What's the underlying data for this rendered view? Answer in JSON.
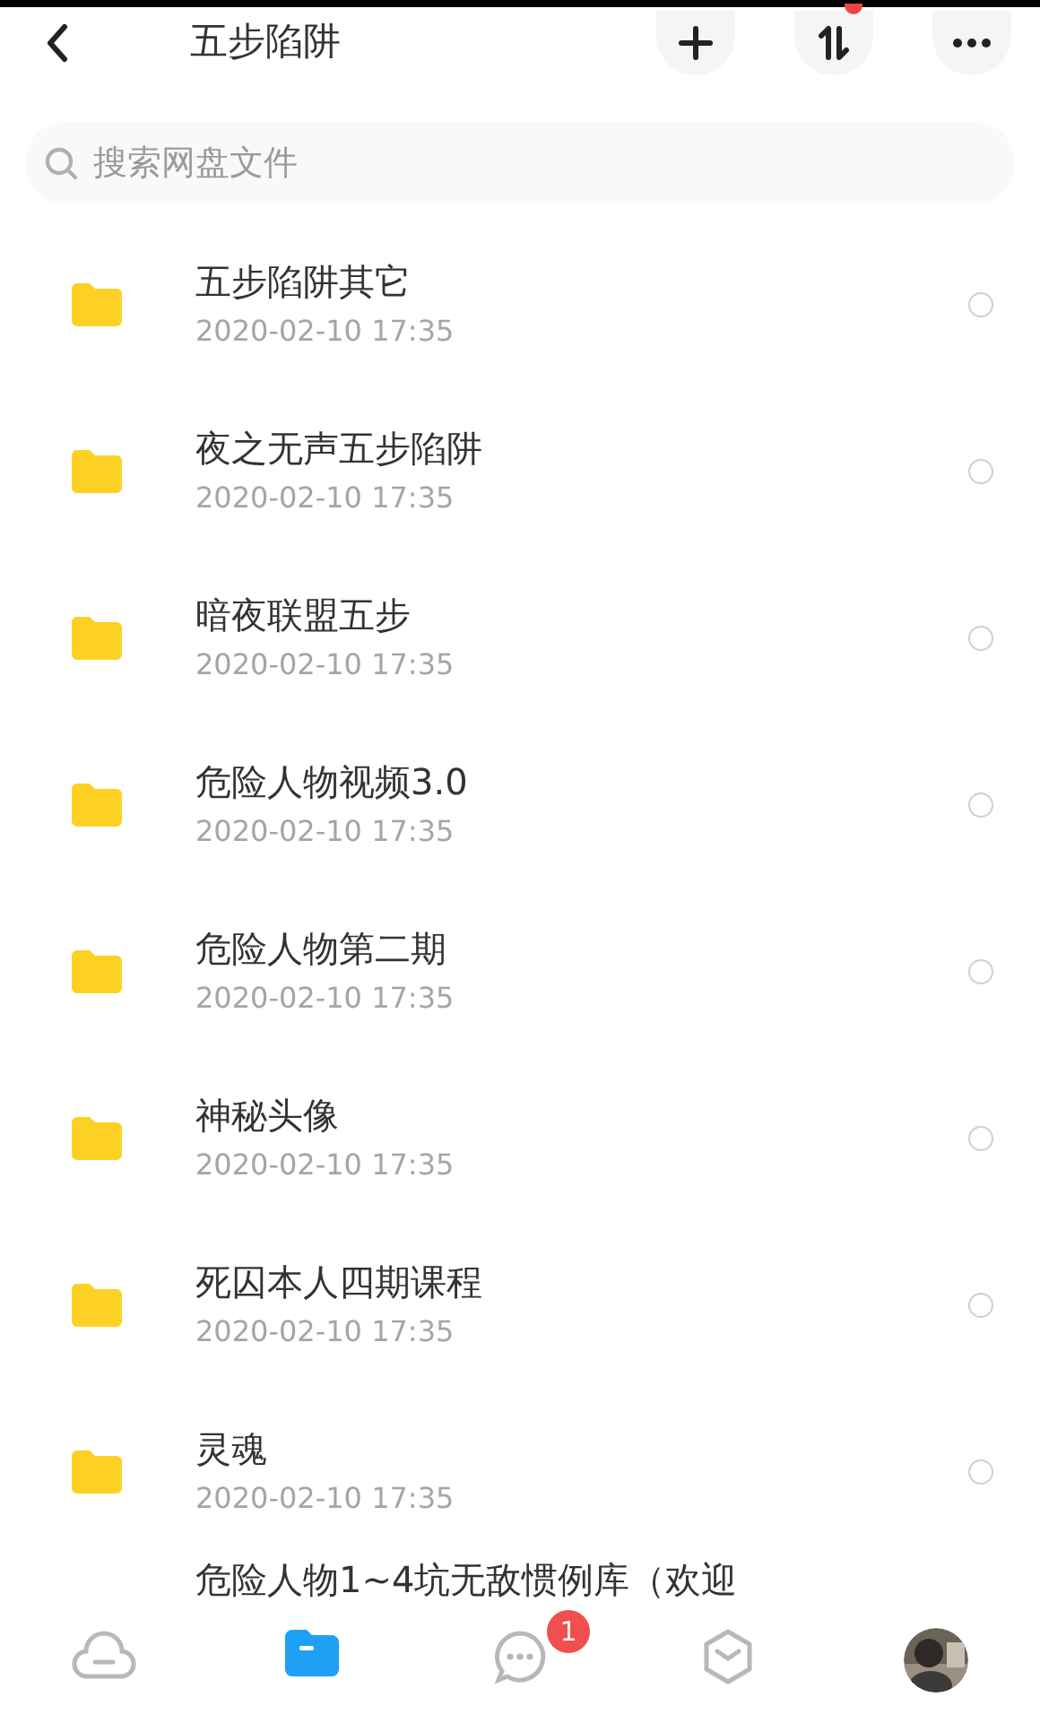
{
  "header": {
    "title": "五步陷阱",
    "sort_badge": true
  },
  "search": {
    "placeholder": "搜索网盘文件"
  },
  "files": [
    {
      "name": "五步陷阱其它",
      "date": "2020-02-10 17:35",
      "checked": false
    },
    {
      "name": "夜之无声五步陷阱",
      "date": "2020-02-10 17:35",
      "checked": false
    },
    {
      "name": "暗夜联盟五步",
      "date": "2020-02-10 17:35",
      "checked": false
    },
    {
      "name": "危险人物视频3.0",
      "date": "2020-02-10 17:35",
      "checked": false
    },
    {
      "name": "危险人物第二期",
      "date": "2020-02-10 17:35",
      "checked": false
    },
    {
      "name": "神秘头像",
      "date": "2020-02-10 17:35",
      "checked": false
    },
    {
      "name": "死囚本人四期课程",
      "date": "2020-02-10 17:35",
      "checked": false
    },
    {
      "name": "灵魂",
      "date": "2020-02-10 17:35",
      "checked": false
    }
  ],
  "partial_file": {
    "name": "危险人物1~4坑无敌惯例库（欢迎"
  },
  "tab_bar": [
    {
      "kind": "home",
      "selected": false
    },
    {
      "kind": "files",
      "selected": true
    },
    {
      "kind": "messages",
      "selected": false,
      "badge": "1"
    },
    {
      "kind": "discover",
      "selected": false
    },
    {
      "kind": "profile",
      "selected": false
    }
  ]
}
